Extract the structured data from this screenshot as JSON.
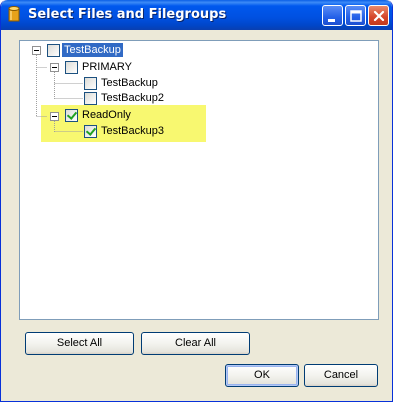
{
  "window": {
    "title": "Select Files and Filegroups",
    "icon": "database-icon",
    "controls": [
      "minimize-icon",
      "maximize-icon",
      "close-icon"
    ]
  },
  "tree": {
    "root": {
      "label": "TestBackup",
      "checked": false,
      "selected": true,
      "expanded": true
    },
    "groups": [
      {
        "label": "PRIMARY",
        "checked": false,
        "expanded": true,
        "files": [
          {
            "label": "TestBackup",
            "checked": false
          },
          {
            "label": "TestBackup2",
            "checked": false
          }
        ]
      },
      {
        "label": "ReadOnly",
        "checked": true,
        "expanded": true,
        "highlighted": true,
        "files": [
          {
            "label": "TestBackup3",
            "checked": true
          }
        ]
      }
    ]
  },
  "buttons": {
    "select_all": "Select All",
    "clear_all": "Clear All",
    "ok": "OK",
    "cancel": "Cancel"
  },
  "colors": {
    "title_bar": "#0054e3",
    "highlight": "#f8f870",
    "selection": "#316ac5",
    "checkmark": "#21a121"
  }
}
